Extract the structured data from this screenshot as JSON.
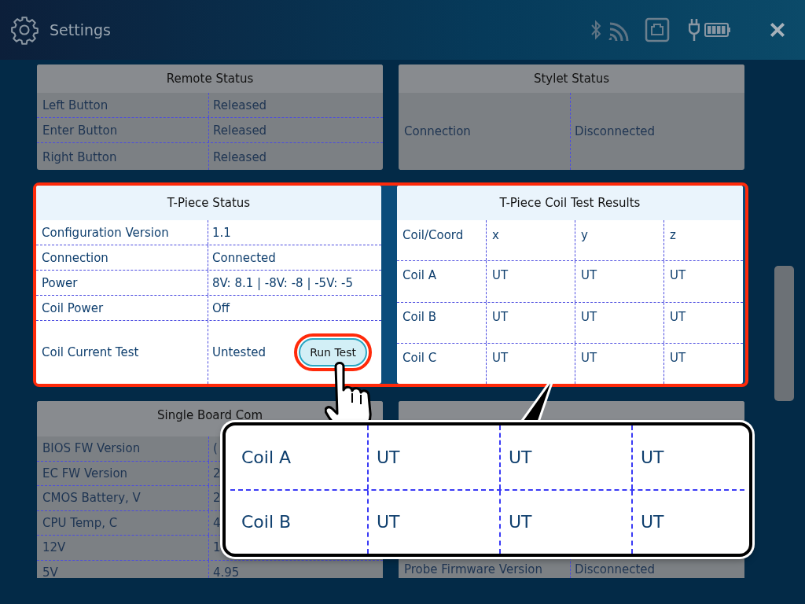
{
  "header": {
    "title": "Settings"
  },
  "card_rows": [
    {
      "cards": [
        {
          "title": "Remote Status",
          "highlighted": false,
          "kind": "list",
          "rows": [
            {
              "label": "Left Button",
              "value": "Released"
            },
            {
              "label": "Enter Button",
              "value": "Released"
            },
            {
              "label": "Right Button",
              "value": "Released"
            }
          ]
        },
        {
          "title": "Stylet Status",
          "highlighted": false,
          "kind": "list",
          "rows": [
            {
              "label": "Connection",
              "value": "Disconnected"
            }
          ]
        }
      ]
    },
    {
      "cards": [
        {
          "title": "T-Piece Status",
          "highlighted": true,
          "kind": "list",
          "rows": [
            {
              "label": "Configuration Version",
              "value": "1.1"
            },
            {
              "label": "Connection",
              "value": "Connected"
            },
            {
              "label": "Power",
              "value": "8V: 8.1 | -8V: -8 | -5V: -5"
            },
            {
              "label": "Coil Power",
              "value": "Off"
            },
            {
              "label": "Coil Current Test",
              "value": "Untested",
              "button": "Run Test"
            }
          ]
        },
        {
          "title": "T-Piece Coil Test Results",
          "highlighted": true,
          "kind": "grid",
          "rows": [
            [
              "Coil/Coord",
              "x",
              "y",
              "z"
            ],
            [
              "Coil A",
              "UT",
              "UT",
              "UT"
            ],
            [
              "Coil B",
              "UT",
              "UT",
              "UT"
            ],
            [
              "Coil C",
              "UT",
              "UT",
              "UT"
            ]
          ]
        }
      ]
    },
    {
      "cards": [
        {
          "title": "Single Board Com",
          "highlighted": false,
          "kind": "list",
          "rows": [
            {
              "label": "BIOS FW Version",
              "value": "("
            },
            {
              "label": "EC FW Version",
              "value": "2"
            },
            {
              "label": "CMOS Battery, V",
              "value": "2"
            },
            {
              "label": "CPU Temp, C",
              "value": "4"
            },
            {
              "label": "12V",
              "value": "1"
            },
            {
              "label": "5V",
              "value": "4.95"
            }
          ]
        },
        {
          "highlighted": false,
          "kind": "list",
          "rows": [
            {
              "label": "Probe Firmware Version",
              "value": "Disconnected"
            }
          ]
        }
      ]
    }
  ],
  "callout": {
    "rows": [
      [
        "Coil A",
        "UT",
        "UT",
        "UT"
      ],
      [
        "Coil B",
        "UT",
        "UT",
        "UT"
      ]
    ]
  }
}
